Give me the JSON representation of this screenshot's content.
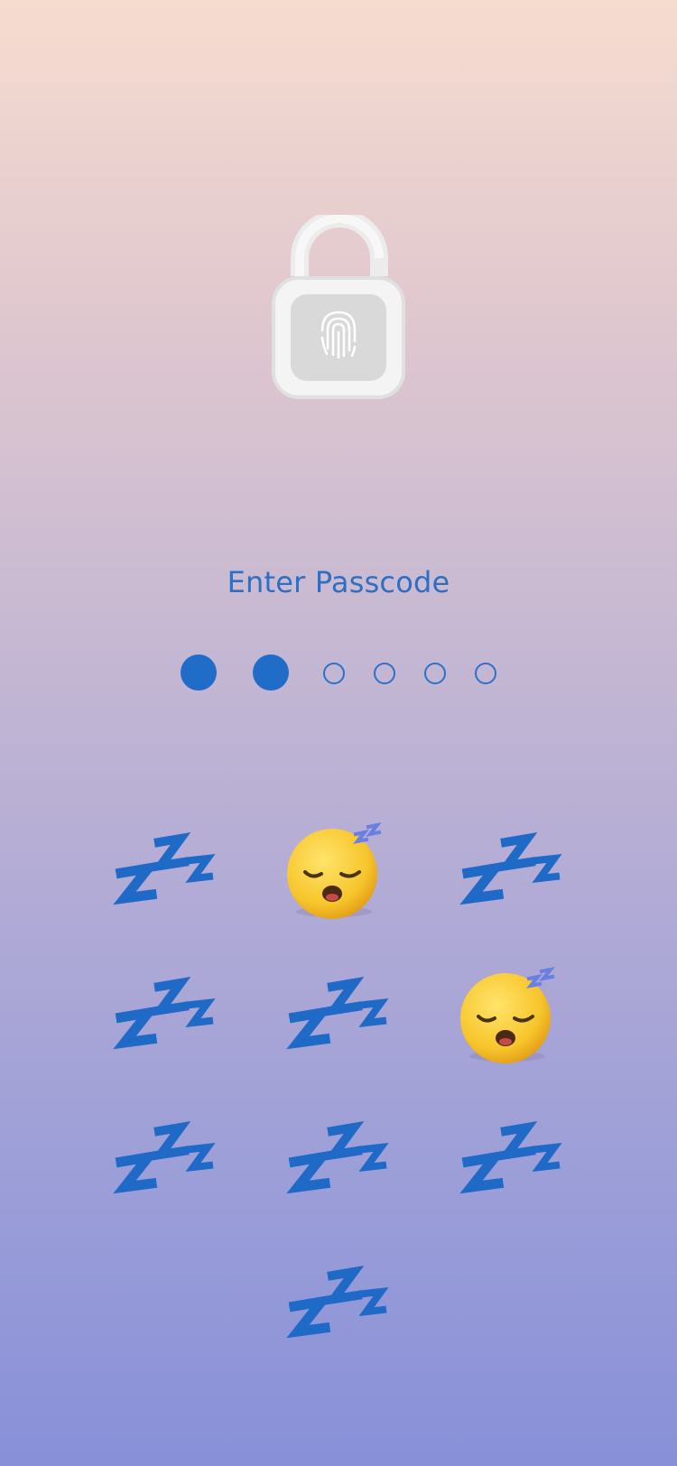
{
  "prompt": {
    "title": "Enter Passcode"
  },
  "passcode": {
    "entered": 2,
    "length": 6
  },
  "colors": {
    "accent": "#1f6dc8",
    "text": "#2d6fc4",
    "lock": "#e6e6e6"
  },
  "keypad": {
    "keys": [
      {
        "icon": "zzz-icon"
      },
      {
        "icon": "sleeping-face-icon"
      },
      {
        "icon": "zzz-icon"
      },
      {
        "icon": "zzz-icon"
      },
      {
        "icon": "zzz-icon"
      },
      {
        "icon": "sleeping-face-icon"
      },
      {
        "icon": "zzz-icon"
      },
      {
        "icon": "zzz-icon"
      },
      {
        "icon": "zzz-icon"
      },
      {
        "icon": "zzz-icon"
      }
    ]
  }
}
